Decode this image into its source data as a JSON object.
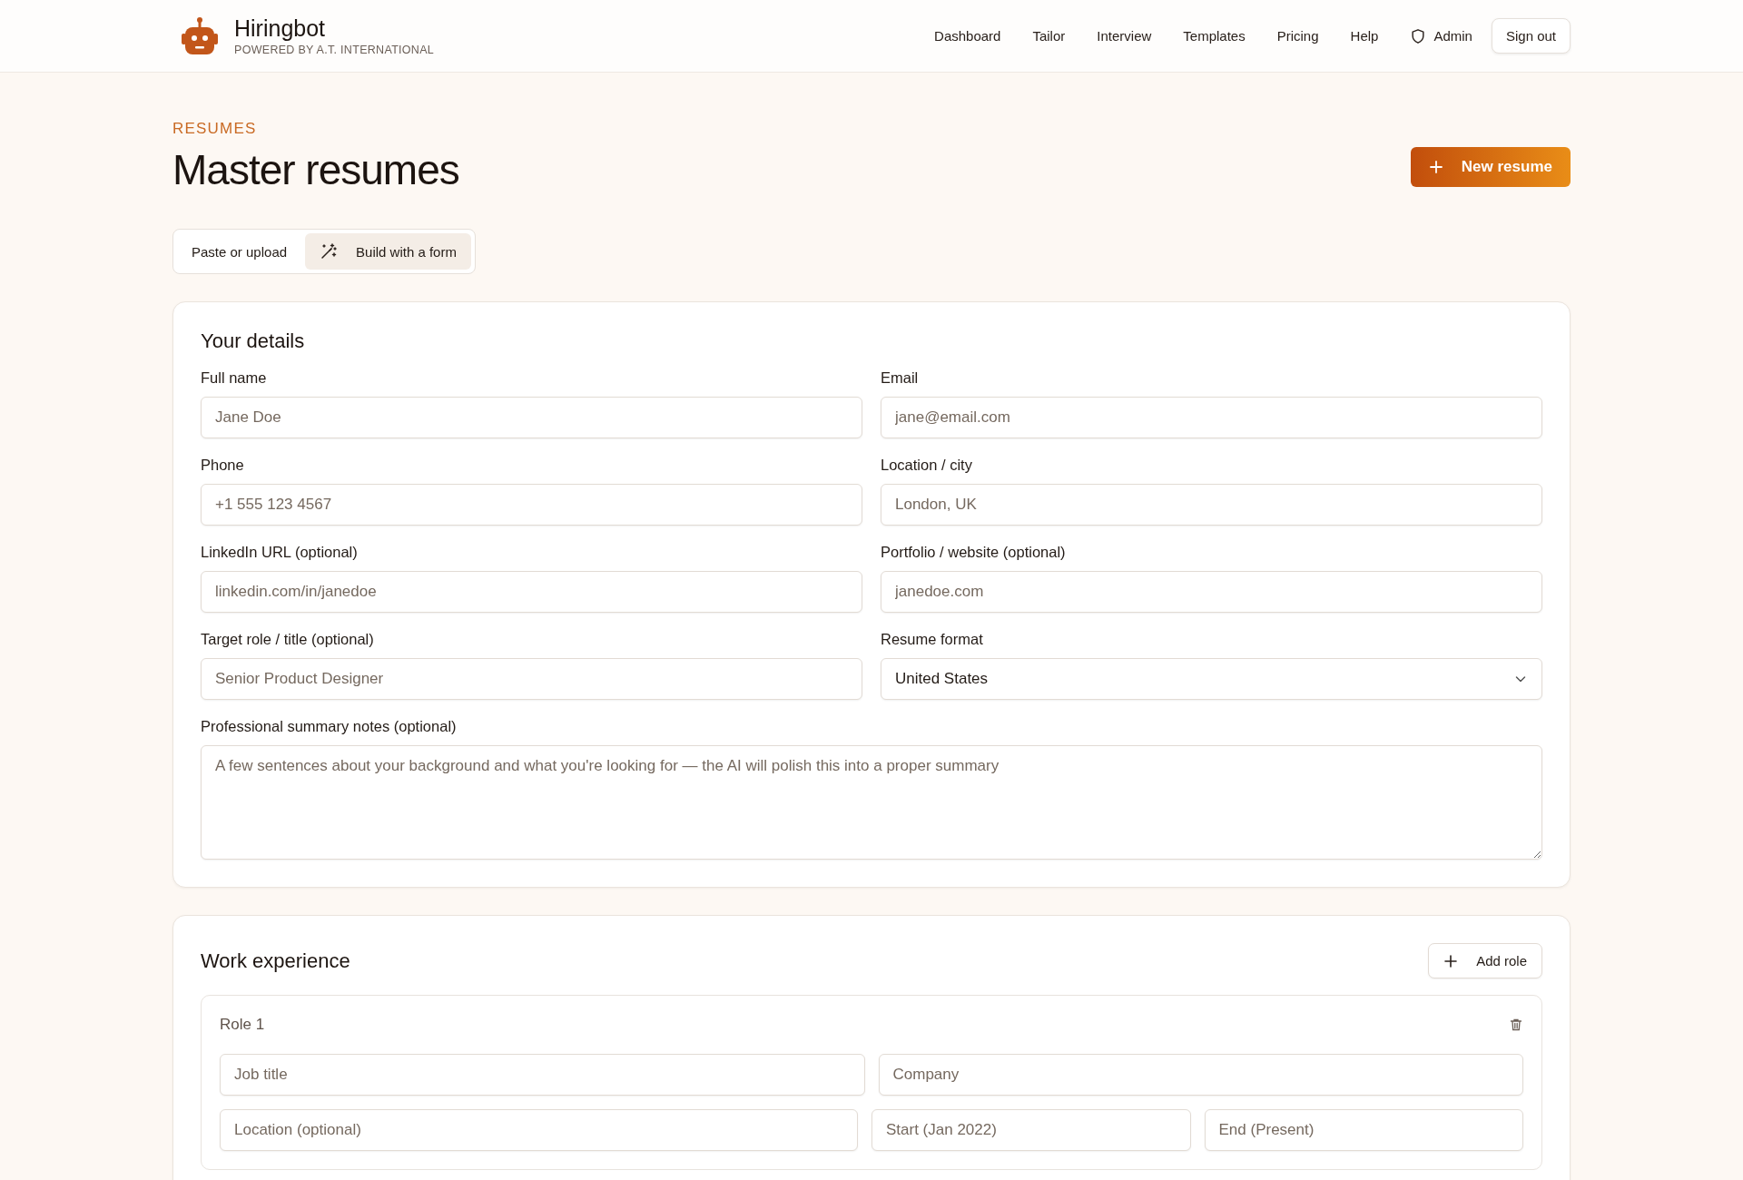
{
  "brand": {
    "name": "Hiringbot",
    "tagline": "POWERED BY A.T. INTERNATIONAL"
  },
  "nav": [
    {
      "label": "Dashboard",
      "kind": "link"
    },
    {
      "label": "Tailor",
      "kind": "link"
    },
    {
      "label": "Interview",
      "kind": "link"
    },
    {
      "label": "Templates",
      "kind": "link"
    },
    {
      "label": "Pricing",
      "kind": "link"
    },
    {
      "label": "Help",
      "kind": "link"
    },
    {
      "label": "Admin",
      "kind": "admin"
    },
    {
      "label": "Sign out",
      "kind": "button"
    }
  ],
  "page": {
    "eyebrow": "RESUMES",
    "title": "Master resumes",
    "new_button": "New resume"
  },
  "mode_tabs": [
    {
      "label": "Paste or upload",
      "selected": false
    },
    {
      "label": "Build with a form",
      "selected": true
    }
  ],
  "details": {
    "title": "Your details",
    "fields": [
      {
        "label": "Full name",
        "placeholder": "Jane Doe",
        "kind": "input"
      },
      {
        "label": "Email",
        "placeholder": "jane@email.com",
        "kind": "input"
      },
      {
        "label": "Phone",
        "placeholder": "+1 555 123 4567",
        "kind": "input"
      },
      {
        "label": "Location / city",
        "placeholder": "London, UK",
        "kind": "input"
      },
      {
        "label": "LinkedIn URL (optional)",
        "placeholder": "linkedin.com/in/janedoe",
        "kind": "input"
      },
      {
        "label": "Portfolio / website (optional)",
        "placeholder": "janedoe.com",
        "kind": "input"
      },
      {
        "label": "Target role / title (optional)",
        "placeholder": "Senior Product Designer",
        "kind": "input"
      },
      {
        "label": "Resume format",
        "value": "United States",
        "kind": "select"
      },
      {
        "label": "Professional summary notes (optional)",
        "placeholder": "A few sentences about your background and what you're looking for — the AI will polish this into a proper summary",
        "kind": "textarea"
      }
    ]
  },
  "work": {
    "title": "Work experience",
    "add_button": "Add role",
    "roles": [
      {
        "title": "Role 1",
        "fields": [
          {
            "placeholder": "Job title"
          },
          {
            "placeholder": "Company"
          }
        ],
        "fields_row2": [
          {
            "placeholder": "Location (optional)"
          },
          {
            "placeholder": "Start (Jan 2022)"
          },
          {
            "placeholder": "End (Present)"
          }
        ]
      }
    ]
  }
}
